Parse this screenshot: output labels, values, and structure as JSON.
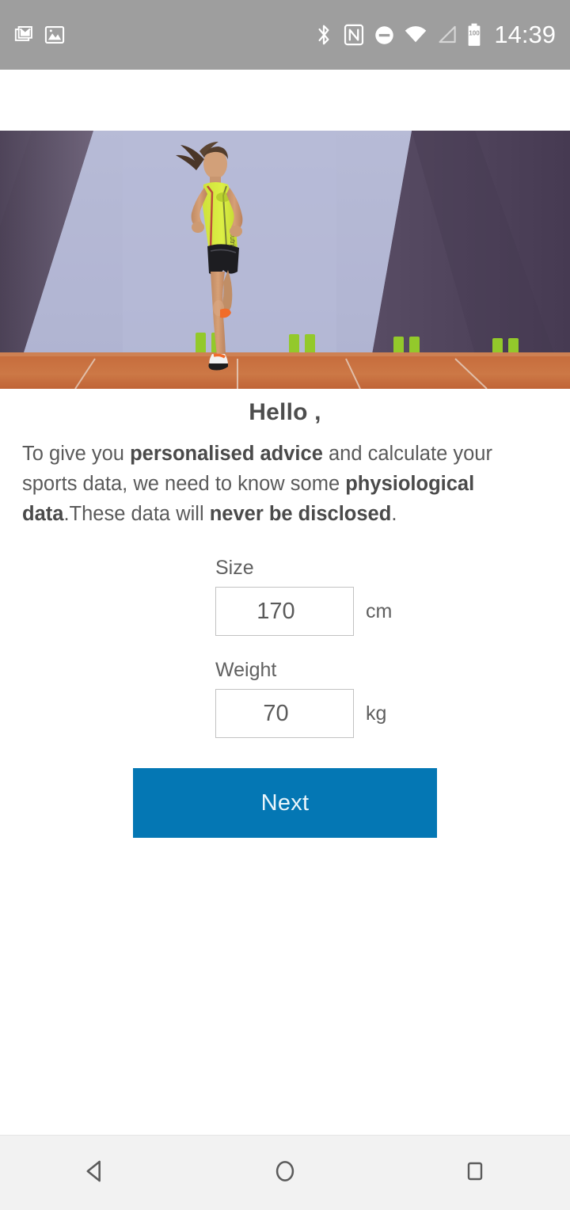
{
  "status_bar": {
    "background": "#9e9e9e",
    "time": "14:39",
    "left_icons": [
      {
        "name": "gmail-icon",
        "label": "Gmail notification"
      },
      {
        "name": "photo-icon",
        "label": "Screenshot notification"
      }
    ],
    "right_icons": [
      {
        "name": "bluetooth-icon",
        "label": "Bluetooth"
      },
      {
        "name": "nfc-icon",
        "label": "NFC"
      },
      {
        "name": "do-not-disturb-icon",
        "label": "Do not disturb"
      },
      {
        "name": "wifi-icon",
        "label": "Wi-Fi"
      },
      {
        "name": "cellular-signal-icon",
        "label": "Mobile signal"
      },
      {
        "name": "battery-icon",
        "label": "Battery",
        "level": "100"
      }
    ]
  },
  "hero": {
    "alt": "Female runner sprinting on an orange indoor running track with purple walls",
    "colors": {
      "wall_light": "#b8bcd8",
      "wall_shadow": "#564a60",
      "wall_dark": "#4f4460",
      "track": "#c3673a",
      "track_light": "#cf8253",
      "singlet": "#d7e83a",
      "shorts": "#1b1b1f",
      "marker_green": "#8fc327",
      "shoe": "#f26b2a"
    }
  },
  "main": {
    "title": "Hello ,",
    "intro": {
      "segments": [
        {
          "text": "To give you ",
          "bold": false
        },
        {
          "text": "personalised advice",
          "bold": true
        },
        {
          "text": " and calculate your sports data, we need to know some ",
          "bold": false
        },
        {
          "text": "physiological data",
          "bold": true
        },
        {
          "text": ".These data will ",
          "bold": false
        },
        {
          "text": "never be disclosed",
          "bold": true
        },
        {
          "text": ".",
          "bold": false
        }
      ]
    },
    "fields": [
      {
        "key": "size",
        "label": "Size",
        "value": "170",
        "placeholder": "170",
        "unit": "cm"
      },
      {
        "key": "weight",
        "label": "Weight",
        "value": "70",
        "placeholder": "70",
        "unit": "kg"
      }
    ],
    "next_button": {
      "label": "Next",
      "background": "#0477b4",
      "text_color": "#eaf5fb"
    }
  },
  "nav_bar": {
    "background": "#f2f2f2",
    "buttons": [
      {
        "name": "back-icon",
        "label": "Back"
      },
      {
        "name": "home-icon",
        "label": "Home"
      },
      {
        "name": "recents-icon",
        "label": "Recent apps"
      }
    ]
  }
}
